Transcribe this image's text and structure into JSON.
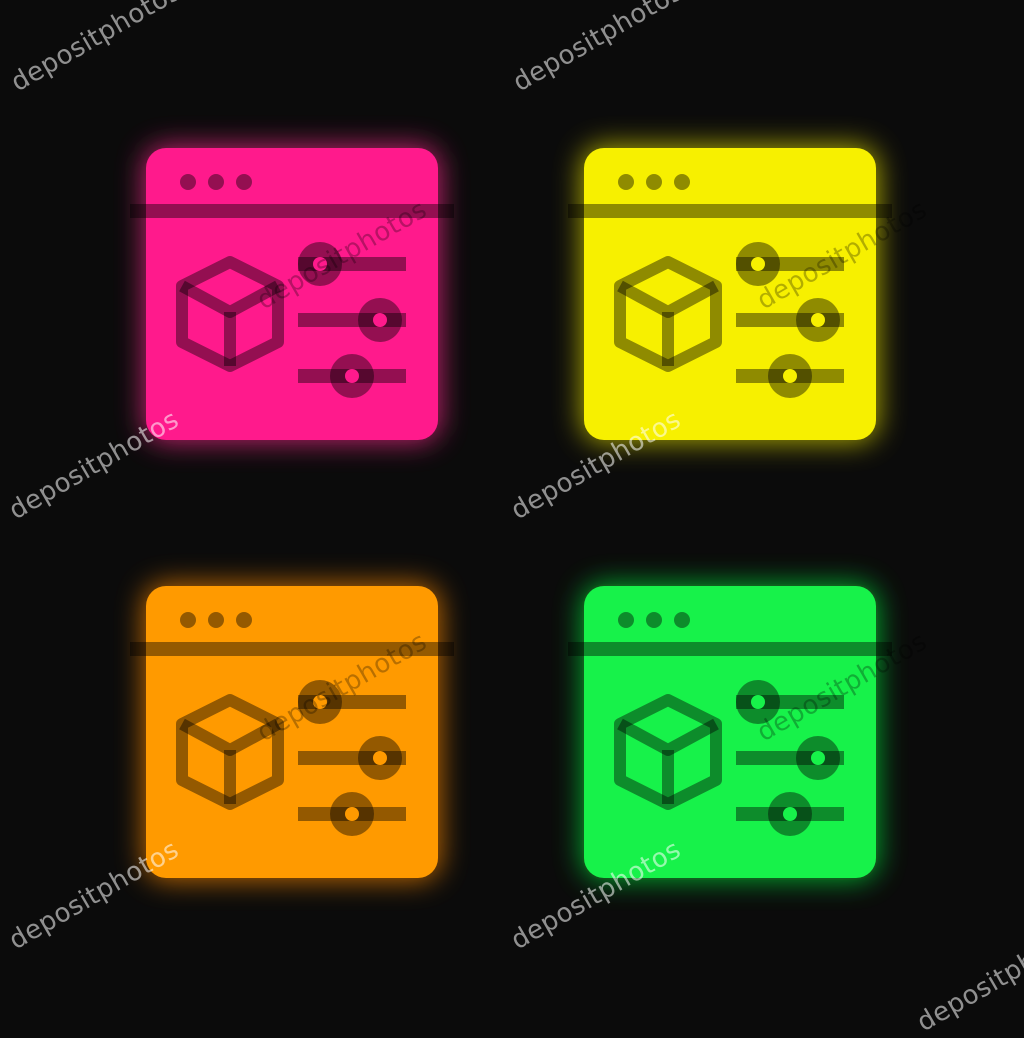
{
  "watermark": {
    "text": "depositphotos"
  },
  "icons": [
    {
      "name": "settings-window-icon-pink",
      "color": "#ff1a8c",
      "glow": "#ff2a8f"
    },
    {
      "name": "settings-window-icon-yellow",
      "color": "#f7f000",
      "glow": "#e6e000"
    },
    {
      "name": "settings-window-icon-orange",
      "color": "#ff9a00",
      "glow": "#ff8a00"
    },
    {
      "name": "settings-window-icon-green",
      "color": "#17f24a",
      "glow": "#10e03a"
    }
  ],
  "background": "#0b0b0b",
  "detail_color": "rgba(0,0,0,0.42)"
}
